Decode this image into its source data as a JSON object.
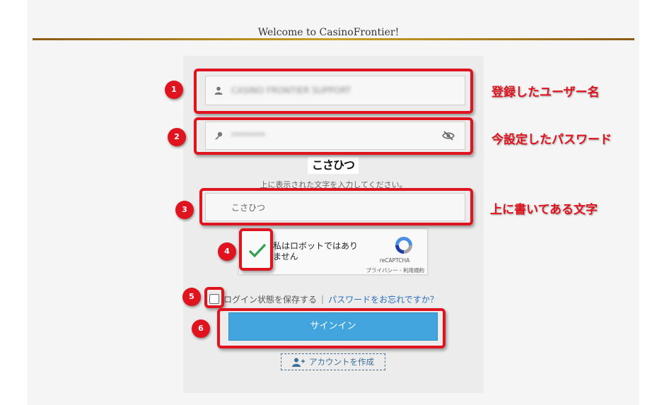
{
  "site": {
    "title": "Welcome to CasinoFrontier!"
  },
  "form": {
    "username_value": "CASINO FRONTIER SUPPORT",
    "password_value": "********",
    "captcha_image_text": "こさひつ",
    "captcha_hint": "上に表示された文字を入力してください。",
    "captcha_input_value": "こさひつ",
    "recaptcha_label": "私はロボットではありません",
    "recaptcha_brand": "reCAPTCHA",
    "recaptcha_links": "プライバシー - 利用規約",
    "remember_label": "ログイン状態を保存する",
    "separator": "|",
    "forgot_password": "パスワードをお忘れですか？",
    "signin_label": "サインイン",
    "create_account_label": "アカウントを作成"
  },
  "annotations": {
    "steps": [
      "1",
      "2",
      "3",
      "4",
      "5",
      "6"
    ],
    "notes": {
      "username": "登録したユーザー名",
      "password": "今設定したパスワード",
      "captcha": "上に書いてある文字"
    },
    "color": "#e0141e"
  },
  "colors": {
    "signin_button": "#42a5dd",
    "link": "#2a6ebb",
    "gold_rule": "#c9a227"
  },
  "icons": [
    "user-icon",
    "key-icon",
    "eye-slash-icon",
    "checkmark-icon",
    "recaptcha-logo-icon",
    "add-user-icon"
  ]
}
